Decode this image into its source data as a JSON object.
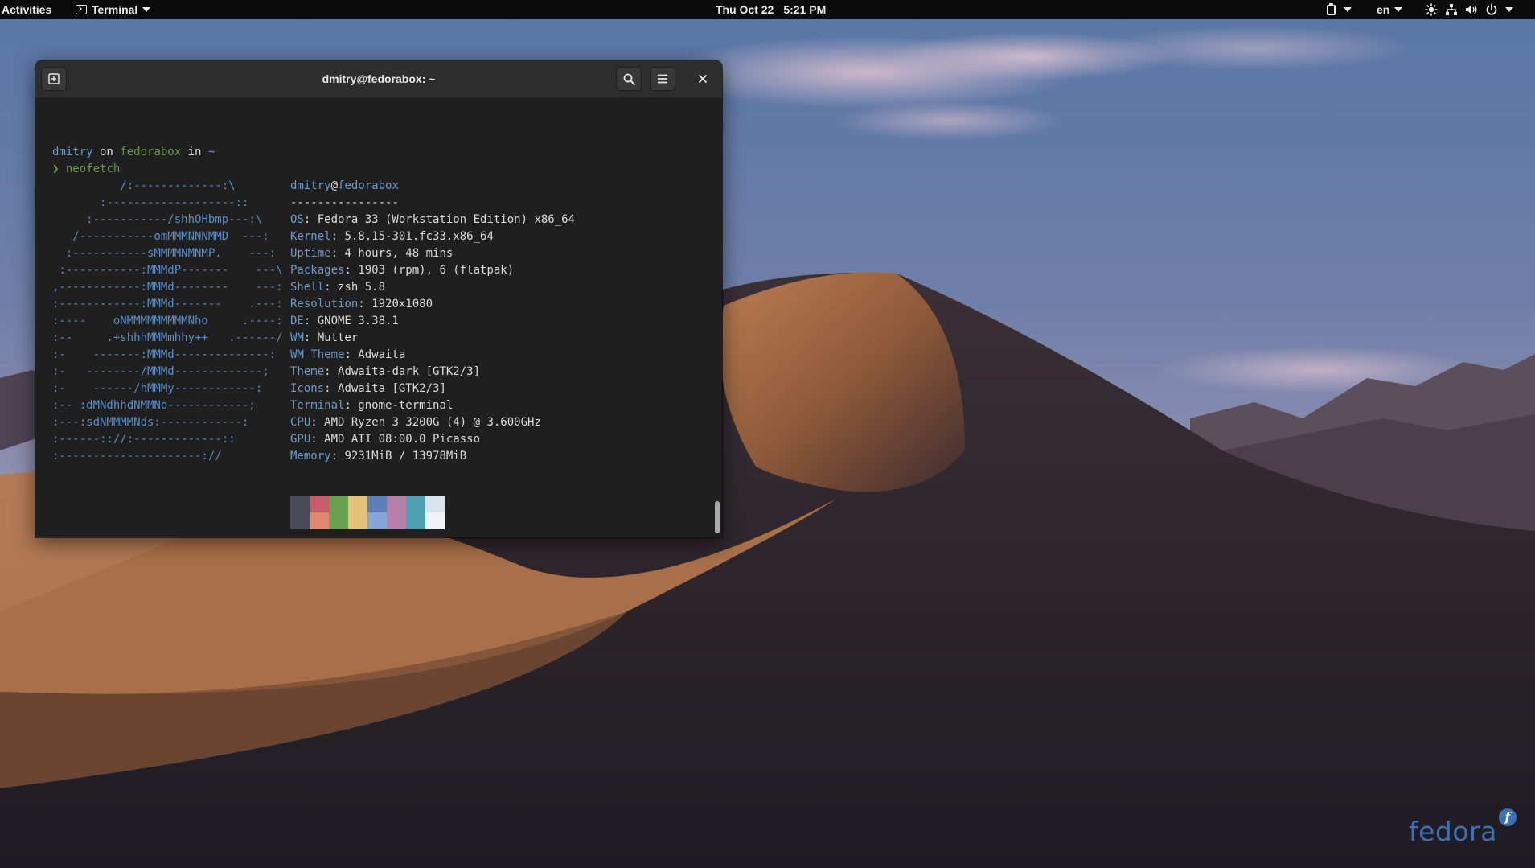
{
  "topbar": {
    "activities": "Activities",
    "app_name": "Terminal",
    "date": "Thu Oct 22",
    "time": "5:21 PM",
    "language": "en",
    "tray_icon_names": [
      "clipboard-icon",
      "brightness-icon",
      "network-icon",
      "volume-icon",
      "power-icon"
    ]
  },
  "terminal": {
    "title": "dmitry@fedorabox: ~",
    "prompt": {
      "user": "dmitry",
      "on": " on ",
      "host": "fedorabox",
      "in": " in ",
      "path": "~",
      "symbol": "❯",
      "command": "neofetch"
    },
    "neofetch": {
      "header_user": "dmitry",
      "header_at": "@",
      "header_host": "fedorabox",
      "separator": "----------------",
      "info": [
        {
          "key": "OS",
          "value": "Fedora 33 (Workstation Edition) x86_64"
        },
        {
          "key": "Kernel",
          "value": "5.8.15-301.fc33.x86_64"
        },
        {
          "key": "Uptime",
          "value": "4 hours, 48 mins"
        },
        {
          "key": "Packages",
          "value": "1903 (rpm), 6 (flatpak)"
        },
        {
          "key": "Shell",
          "value": "zsh 5.8"
        },
        {
          "key": "Resolution",
          "value": "1920x1080"
        },
        {
          "key": "DE",
          "value": "GNOME 3.38.1"
        },
        {
          "key": "WM",
          "value": "Mutter"
        },
        {
          "key": "WM Theme",
          "value": "Adwaita"
        },
        {
          "key": "Theme",
          "value": "Adwaita-dark [GTK2/3]"
        },
        {
          "key": "Icons",
          "value": "Adwaita [GTK2/3]"
        },
        {
          "key": "Terminal",
          "value": "gnome-terminal"
        },
        {
          "key": "CPU",
          "value": "AMD Ryzen 3 3200G (4) @ 3.600GHz"
        },
        {
          "key": "GPU",
          "value": "AMD ATI 08:00.0 Picasso"
        },
        {
          "key": "Memory",
          "value": "9231MiB / 13978MiB"
        }
      ],
      "ascii_art": [
        "          /:-------------:\\",
        "       :-------------------::",
        "     :-----------/shhOHbmp---:\\",
        "   /-----------omMMMNNNMMD  ---:",
        "  :-----------sMMMMNMNMP.    ---:",
        " :-----------:MMMdP-------    ---\\",
        ",------------:MMMd--------    ---:",
        ":------------:MMMd-------    .---:",
        ":----    oNMMMMMMMMMNho     .----:",
        ":--     .+shhhMMMmhhy++   .------/",
        ":-    -------:MMMd--------------:",
        ":-   --------/MMMd-------------;",
        ":-    ------/hMMMy------------:",
        ":-- :dMNdhhdNMMNo------------;",
        ":---:sdNMMMMNds:------------:",
        ":------:://:-------------::",
        ":---------------------://"
      ],
      "palette_top": [
        "#4a4a58",
        "#c75c6a",
        "#6aa04e",
        "#e5c279",
        "#5b7fb8",
        "#b780a8",
        "#4aa0b0",
        "#d9e2ee"
      ],
      "palette_bottom": [
        "#4a4a58",
        "#e0886e",
        "#6aa04e",
        "#e5c279",
        "#85a6d6",
        "#b780a8",
        "#4aa0b0",
        "#eef2f7"
      ]
    }
  },
  "wallpaper_logo": {
    "text": "fedora",
    "badge": "f"
  }
}
